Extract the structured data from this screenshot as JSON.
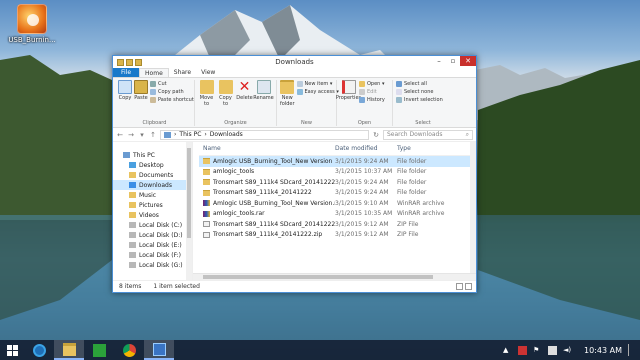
{
  "desktop": {
    "icon_label": "USB_Burnin..."
  },
  "window": {
    "title": "Downloads",
    "tabs": [
      "File",
      "Home",
      "Share",
      "View"
    ],
    "ribbon": {
      "clipboard": {
        "label": "Clipboard",
        "copy": "Copy",
        "paste": "Paste",
        "cut": "Cut",
        "copy_path": "Copy path",
        "paste_shortcut": "Paste shortcut"
      },
      "organize": {
        "label": "Organize",
        "move_to": "Move to",
        "copy_to": "Copy to",
        "delete": "Delete",
        "rename": "Rename"
      },
      "new": {
        "label": "New",
        "new_folder": "New folder",
        "new_item": "New item ▾",
        "easy_access": "Easy access ▾"
      },
      "open": {
        "label": "Open",
        "properties": "Properties",
        "open": "Open ▾",
        "edit": "Edit",
        "history": "History"
      },
      "select": {
        "label": "Select",
        "select_all": "Select all",
        "select_none": "Select none",
        "invert": "Invert selection"
      }
    },
    "address": {
      "path": [
        "This PC",
        "Downloads"
      ],
      "search_placeholder": "Search Downloads"
    },
    "nav": [
      {
        "label": "This PC",
        "level": 0
      },
      {
        "label": "Desktop",
        "level": 1
      },
      {
        "label": "Documents",
        "level": 1
      },
      {
        "label": "Downloads",
        "level": 1
      },
      {
        "label": "Music",
        "level": 1
      },
      {
        "label": "Pictures",
        "level": 1
      },
      {
        "label": "Videos",
        "level": 1
      },
      {
        "label": "Local Disk (C:)",
        "level": 1
      },
      {
        "label": "Local Disk (D:)",
        "level": 1
      },
      {
        "label": "Local Disk (E:)",
        "level": 1
      },
      {
        "label": "Local Disk (F:)",
        "level": 1
      },
      {
        "label": "Local Disk (G:)",
        "level": 1
      }
    ],
    "columns": {
      "name": "Name",
      "date": "Date modified",
      "type": "Type"
    },
    "files": [
      {
        "name": "Amlogic USB_Burning_Tool_New Version",
        "date": "3/1/2015 9:24 AM",
        "type": "File folder",
        "kind": "folder"
      },
      {
        "name": "amlogic_tools",
        "date": "3/1/2015 10:37 AM",
        "type": "File folder",
        "kind": "folder"
      },
      {
        "name": "Tronsmart S89_111k4 SDcard_20141222",
        "date": "3/1/2015 9:24 AM",
        "type": "File folder",
        "kind": "folder"
      },
      {
        "name": "Tronsmart S89_111k4_20141222",
        "date": "3/1/2015 9:24 AM",
        "type": "File folder",
        "kind": "folder"
      },
      {
        "name": "Amlogic USB_Burning_Tool_New Version.rar",
        "date": "3/1/2015 9:10 AM",
        "type": "WinRAR archive",
        "kind": "rar"
      },
      {
        "name": "amlogic_tools.rar",
        "date": "3/1/2015 10:35 AM",
        "type": "WinRAR archive",
        "kind": "rar"
      },
      {
        "name": "Tronsmart S89_111k4 SDcard_20141222.zip",
        "date": "3/1/2015 9:12 AM",
        "type": "ZIP File",
        "kind": "zip"
      },
      {
        "name": "Tronsmart S89_111k4_20141222.zip",
        "date": "3/1/2015 9:12 AM",
        "type": "ZIP File",
        "kind": "zip"
      }
    ],
    "status": {
      "items": "8 items",
      "selected": "1 item selected"
    }
  },
  "taskbar": {
    "clock": "10:43 AM"
  }
}
